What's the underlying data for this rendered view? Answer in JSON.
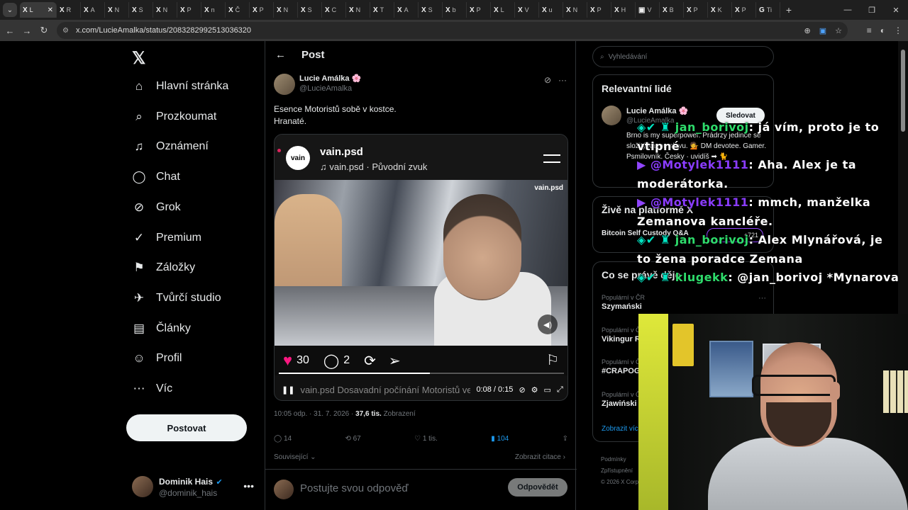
{
  "browser": {
    "tabs": [
      {
        "fav": "X",
        "label": "L"
      },
      {
        "fav": "X",
        "label": "R"
      },
      {
        "fav": "X",
        "label": "A"
      },
      {
        "fav": "X",
        "label": "N"
      },
      {
        "fav": "X",
        "label": "S"
      },
      {
        "fav": "X",
        "label": "N"
      },
      {
        "fav": "X",
        "label": "P"
      },
      {
        "fav": "X",
        "label": "n"
      },
      {
        "fav": "X",
        "label": "Č"
      },
      {
        "fav": "X",
        "label": "P"
      },
      {
        "fav": "X",
        "label": "N"
      },
      {
        "fav": "X",
        "label": "S"
      },
      {
        "fav": "X",
        "label": "C"
      },
      {
        "fav": "X",
        "label": "N"
      },
      {
        "fav": "X",
        "label": "T"
      },
      {
        "fav": "X",
        "label": "A"
      },
      {
        "fav": "X",
        "label": "S"
      },
      {
        "fav": "X",
        "label": "b"
      },
      {
        "fav": "X",
        "label": "P"
      },
      {
        "fav": "X",
        "label": "L"
      },
      {
        "fav": "X",
        "label": "V"
      },
      {
        "fav": "X",
        "label": "u"
      },
      {
        "fav": "X",
        "label": "N"
      },
      {
        "fav": "X",
        "label": "P"
      },
      {
        "fav": "X",
        "label": "H"
      },
      {
        "fav": "▣",
        "label": "V"
      },
      {
        "fav": "X",
        "label": "B"
      },
      {
        "fav": "X",
        "label": "P"
      },
      {
        "fav": "X",
        "label": "K"
      },
      {
        "fav": "X",
        "label": "P"
      },
      {
        "fav": "G",
        "label": "Ti"
      }
    ],
    "url": "x.com/LucieAmalka/status/2083282992513036320"
  },
  "nav": {
    "items": [
      {
        "icon": "⌂",
        "label": "Hlavní stránka"
      },
      {
        "icon": "⌕",
        "label": "Prozkoumat"
      },
      {
        "icon": "♫",
        "label": "Oznámení"
      },
      {
        "icon": "◯",
        "label": "Chat"
      },
      {
        "icon": "⊘",
        "label": "Grok"
      },
      {
        "icon": "✓",
        "label": "Premium"
      },
      {
        "icon": "⚑",
        "label": "Záložky"
      },
      {
        "icon": "✈",
        "label": "Tvůrčí studio"
      },
      {
        "icon": "▤",
        "label": "Články"
      },
      {
        "icon": "☺",
        "label": "Profil"
      },
      {
        "icon": "⋯",
        "label": "Víc"
      }
    ],
    "post_button": "Postovat",
    "account": {
      "name": "Dominik Hais",
      "handle": "@dominik_hais"
    }
  },
  "post": {
    "header_title": "Post",
    "author_name": "Lucie Amálka 🌸",
    "author_handle": "@LucieAmalka",
    "text_line1": "Esence Motoristů sobě v kostce.",
    "text_line2": "Hranaté.",
    "media": {
      "account": "vain.psd",
      "logo_text": "vain",
      "audio": "♫ vain.psd · Původní zvuk",
      "watermark": "vain.psd",
      "likes": "30",
      "comments": "2",
      "caption": "vain.psd Dosavadní počínání Motoristů ve vládě",
      "time": "0:08 / 0:15",
      "progress": 0.53
    },
    "timestamp": "10:05 odp. · 31. 7. 2026 · ",
    "views": "37,6 tis.",
    "views_label": " Zobrazení",
    "stats": {
      "replies": "14",
      "reposts": "67",
      "likes": "1 tis.",
      "bookmarks": "104"
    },
    "related_label": "Související",
    "citations_label": "Zobrazit citace",
    "reply_placeholder": "Postujte svou odpověď",
    "reply_button": "Odpovědět"
  },
  "sidebar": {
    "search_placeholder": "Vyhledávání",
    "relevant_title": "Relevantní lidé",
    "person": {
      "name": "Lucie Amálka 🌸",
      "handle": "@LucieAmalka",
      "bio": "Brno is my superpower. Prádrzy jedince se složitý kánon slovu. 💁 DM devotee. Gamer. Psmilovník. Česky · uvidíš ➡ 🐈",
      "follow": "Sledovat"
    },
    "live_title": "Živě na platformě X",
    "live_item": "Bitcoin Self Custody Q&A",
    "live_count": "+721",
    "trends_title": "Co se právě děje",
    "trends": [
      {
        "context": "Populární v ČR",
        "name": "Szymański"
      },
      {
        "context": "Populární v ČR",
        "name": "Vikingur R"
      },
      {
        "context": "Populární v ČR",
        "name": "#CRAPOG"
      },
      {
        "context": "Populární v ČR",
        "name": "Zjawiński"
      }
    ],
    "show_more": "Zobrazit víc",
    "footer_line1": "Podmínky",
    "footer_line2": "Zpřístupnění",
    "footer_line3": "© 2026 X Corp."
  },
  "chat_overlay": [
    {
      "user": "jan_borivoj",
      "user_color": "green",
      "message": ": já vím, proto je to vtipné"
    },
    {
      "user": "@Motylek1111",
      "user_color": "purple",
      "message": ": Aha. Alex je ta moderátorka."
    },
    {
      "user": "@Motylek1111",
      "user_color": "purple",
      "message": ": mmch, manželka Zemanova kancléře."
    },
    {
      "user": "jan_borivoj",
      "user_color": "green",
      "message": ": Alex Mlynářová, je to žena poradce Zemana"
    },
    {
      "user": "klugekk",
      "user_color": "green",
      "message": ": @jan_borivoj *Mynarova"
    }
  ]
}
